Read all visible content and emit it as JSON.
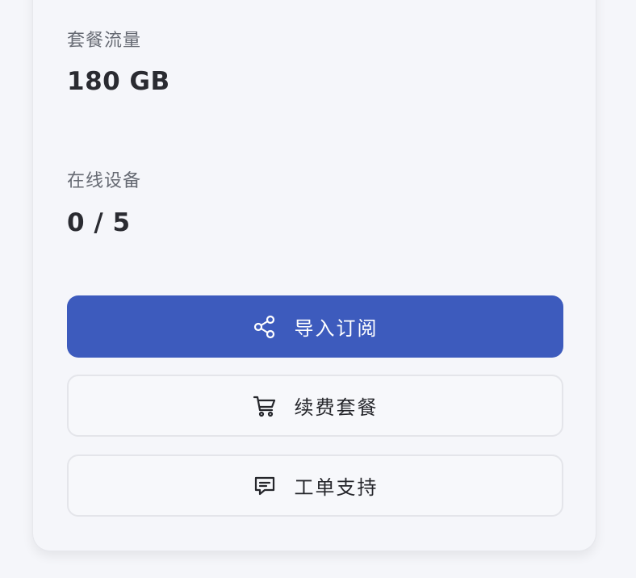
{
  "plan": {
    "traffic_label": "套餐流量",
    "traffic_value": "180 GB",
    "devices_label": "在线设备",
    "devices_value": "0 / 5"
  },
  "actions": {
    "import_label": "导入订阅",
    "renew_label": "续费套餐",
    "support_label": "工单支持"
  },
  "icons": {
    "import": "share-icon",
    "renew": "cart-icon",
    "support": "message-icon"
  },
  "colors": {
    "primary": "#3d5bbd",
    "background": "#f5f6fa"
  }
}
